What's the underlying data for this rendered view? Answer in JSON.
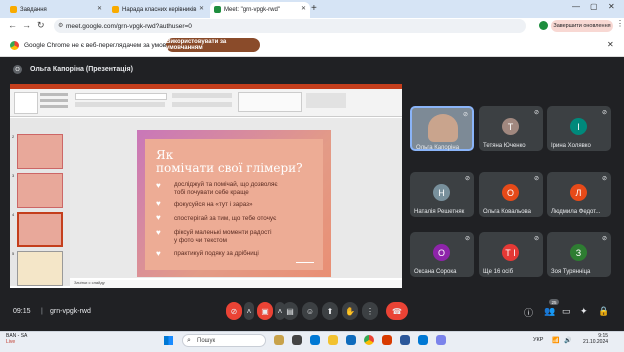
{
  "browser": {
    "tabs": [
      {
        "label": "Завдання",
        "color": "#f9ab00"
      },
      {
        "label": "Нарада класних керівників",
        "color": "#f9ab00"
      },
      {
        "label": "Meet: \"grn-vpgk-rwd\"",
        "color": "#1e8e3e"
      }
    ],
    "new_tab": "+",
    "url": "meet.google.com/grn-vpgk-rwd?authuser=0",
    "update_button": "Завершити оновлення",
    "infobar_text": "Google Chrome не є веб-переглядачем за умовчанням",
    "infobar_button": "Використовувати за умовчанням"
  },
  "meet": {
    "presenter_initial": "О",
    "presenter_title": "Ольга Капоріна (Презентація)",
    "time": "09:15",
    "separator": "|",
    "code": "grn-vpgk-rwd",
    "participant_count": "25"
  },
  "presentation": {
    "title_line1": "Як",
    "title_line2": "помічати свої глімери?",
    "bullets": [
      "досліджуй та помічай, що дозволяє",
      "тобі почувати себе краще",
      "фокусуйся на «тут і зараз»",
      "спостерігай за тим, що тебе оточує",
      "фіксуй маленькі моменти радості",
      "у фото чи текстом",
      "практикуй подяку за дрібниці"
    ],
    "notes": "Зачітки с слайду",
    "thumb_numbers": [
      "2",
      "3",
      "4",
      "5"
    ]
  },
  "participants": [
    {
      "name": "Ольга Капоріна",
      "initial": "",
      "color": "#6b7b8c",
      "video": true
    },
    {
      "name": "Тетяна Юченко",
      "initial": "Т",
      "color": "#a1887f"
    },
    {
      "name": "Ірина Холявко",
      "initial": "І",
      "color": "#00897b"
    },
    {
      "name": "Наталія Решетняк",
      "initial": "Н",
      "color": "#78909c"
    },
    {
      "name": "Ольга Ковальова",
      "initial": "О",
      "color": "#e64a19"
    },
    {
      "name": "Людмила Федот...",
      "initial": "Л",
      "color": "#e64a19"
    },
    {
      "name": "Оксана Сорока",
      "initial": "О",
      "color": "#8e24aa"
    },
    {
      "name": "Ще 16 осіб",
      "initial": "Т І",
      "color": "#e53935"
    },
    {
      "name": "Зоя Турянніца",
      "initial": "З",
      "color": "#2e7d32"
    }
  ],
  "taskbar": {
    "weather_temp": "BAN - SA",
    "weather_desc": "Live",
    "search_placeholder": "Пошук",
    "lang": "УКР",
    "clock_time": "9:15",
    "clock_date": "21.10.2024"
  }
}
